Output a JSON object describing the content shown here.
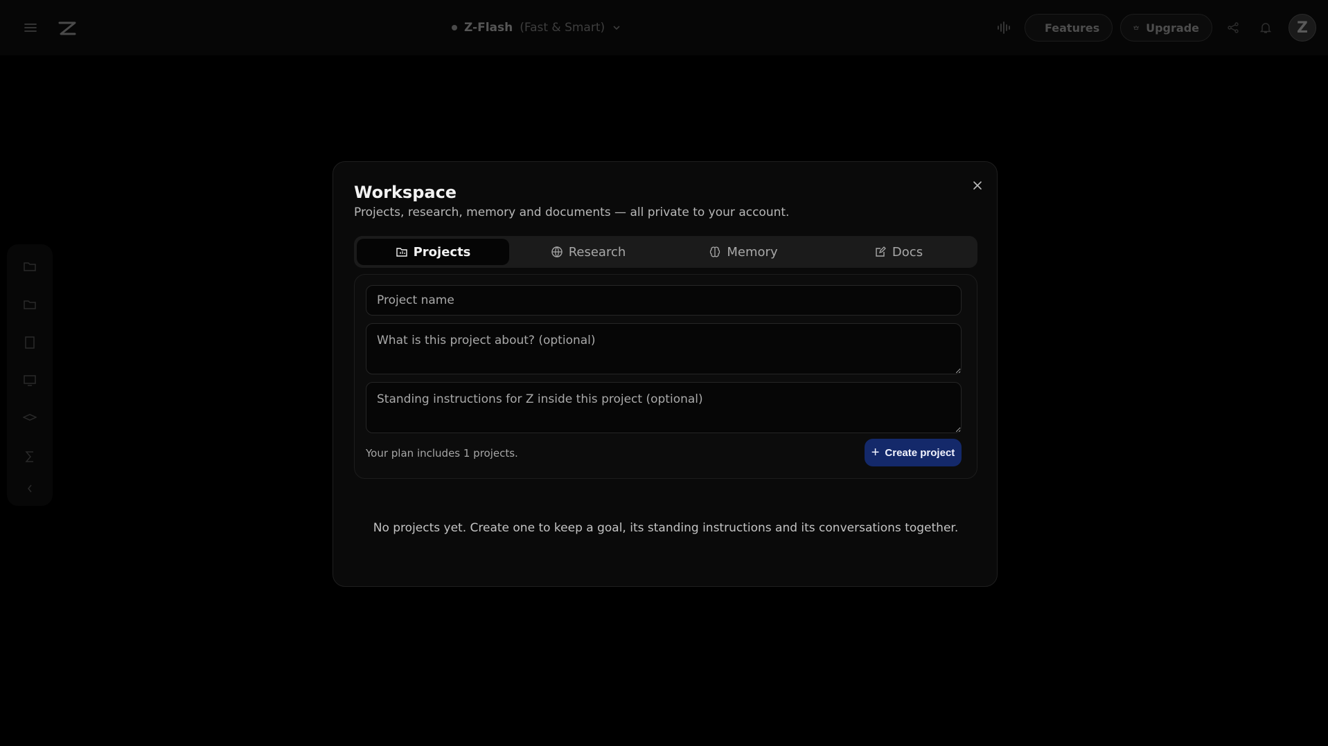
{
  "topbar": {
    "model_name": "Z-Flash",
    "model_sub": "(Fast & Smart)",
    "features_label": "Features",
    "upgrade_label": "Upgrade",
    "avatar_letter": "Z"
  },
  "modal": {
    "title": "Workspace",
    "subtitle": "Projects, research, memory and documents — all private to your account.",
    "tabs": [
      {
        "label": "Projects",
        "icon": "folder-icon",
        "active": true
      },
      {
        "label": "Research",
        "icon": "globe-icon",
        "active": false
      },
      {
        "label": "Memory",
        "icon": "brain-icon",
        "active": false
      },
      {
        "label": "Docs",
        "icon": "edit-doc-icon",
        "active": false
      }
    ],
    "form": {
      "name_placeholder": "Project name",
      "about_placeholder": "What is this project about? (optional)",
      "instructions_placeholder": "Standing instructions for Z inside this project (optional)",
      "plan_note": "Your plan includes 1 projects.",
      "create_label": "Create project"
    },
    "empty_note": "No projects yet. Create one to keep a goal, its standing instructions and its conversations together."
  },
  "colors": {
    "accent_button": "#14296a",
    "modal_bg": "#0a0a0a",
    "page_bg": "#000000"
  }
}
